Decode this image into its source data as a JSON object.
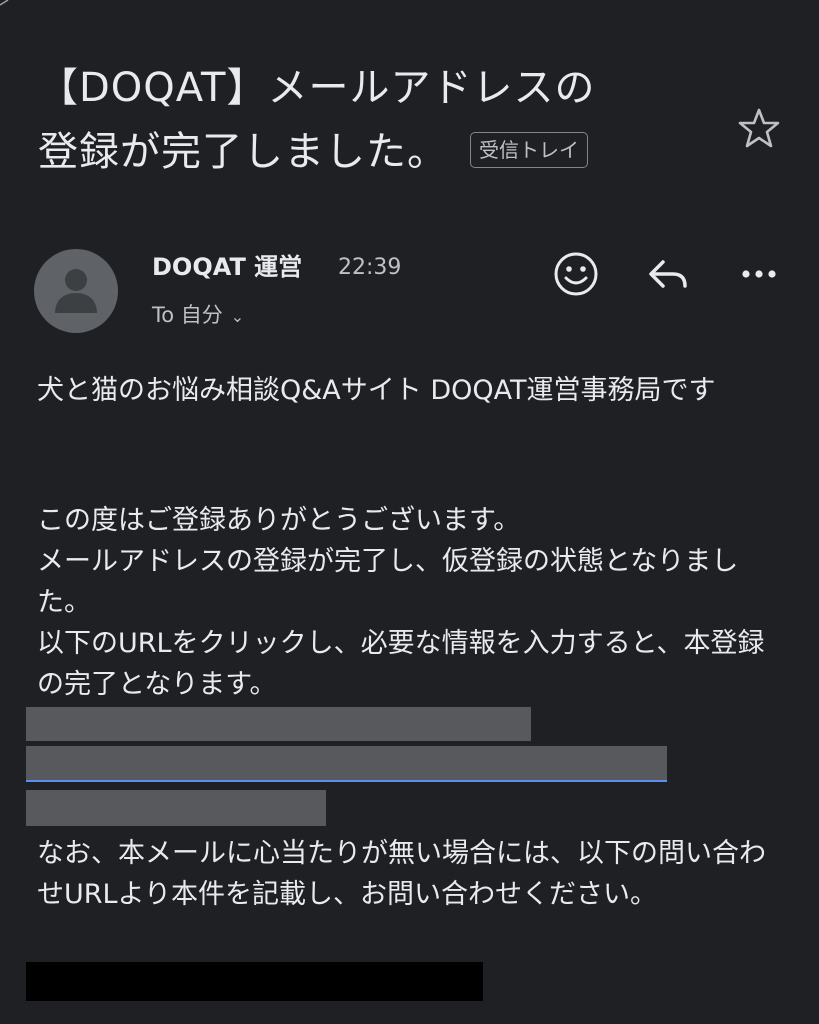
{
  "email": {
    "subject_line1": "【DOQAT】メールアドレスの",
    "subject_line2": "登録が完了しました。",
    "label": "受信トレイ",
    "sender": "DOQAT 運営",
    "time": "22:39",
    "recipient": "To 自分",
    "intro": "犬と猫のお悩み相談Q&Aサイト DOQAT運営事務局です",
    "body_lines": [
      "この度はご登録ありがとうございます。",
      "メールアドレスの登録が完了し、仮登録の状態となりました。",
      "以下のURLをクリックし、必要な情報を入力すると、本登録の完了となります。"
    ],
    "outro": "なお、本メールに心当たりが無い場合には、以下の問い合わせURLより本件を記載し、お問い合わせください。"
  },
  "icons": {
    "star": "star-icon",
    "avatar": "person-icon",
    "emoji": "emoji-icon",
    "reply": "reply-icon",
    "more": "more-icon",
    "chevron": "chevron-down-icon"
  },
  "colors": {
    "background": "#1f2023",
    "text": "#e8eaed",
    "secondary_text": "#bdc1c6",
    "link_underline": "#5b8ff0",
    "redaction": "#58595c"
  }
}
